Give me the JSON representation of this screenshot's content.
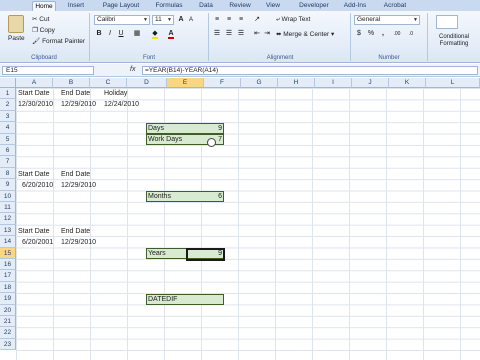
{
  "tabs": [
    "Home",
    "Insert",
    "Page Layout",
    "Formulas",
    "Data",
    "Review",
    "View",
    "Developer",
    "Add-Ins",
    "Acrobat"
  ],
  "active_tab": "Home",
  "ribbon": {
    "paste": "Paste",
    "cut": "Cut",
    "copy": "Copy",
    "format_painter": "Format Painter",
    "clipboard": "Clipboard",
    "font_name": "Calibri",
    "font_size": "11",
    "font": "Font",
    "wrap_text": "Wrap Text",
    "merge_center": "Merge & Center",
    "alignment": "Alignment",
    "number_format": "General",
    "number": "Number",
    "conditional_formatting": "Conditional Formatting"
  },
  "formula_bar": {
    "name_box": "E15",
    "fx": "fx",
    "formula": "=YEAR(B14)-YEAR(A14)"
  },
  "columns": [
    "A",
    "B",
    "C",
    "D",
    "E",
    "F",
    "G",
    "H",
    "I",
    "J",
    "K",
    "L"
  ],
  "rows": [
    "1",
    "2",
    "3",
    "4",
    "5",
    "6",
    "7",
    "8",
    "9",
    "10",
    "11",
    "12",
    "13",
    "14",
    "15",
    "16",
    "17",
    "18",
    "19",
    "20",
    "21",
    "22",
    "23"
  ],
  "cells": {
    "a1": "Start Date",
    "b1": "End Date",
    "c1": "Holiday",
    "a2": "12/30/2010",
    "b2": "12/29/2010",
    "c2": "12/24/2010",
    "d4": "Days",
    "e4": "9",
    "d5": "Work Days",
    "e5": "7",
    "a8": "Start Date",
    "b8": "End Date",
    "a9": "6/20/2010",
    "b9": "12/29/2010",
    "d10": "Months",
    "e10": "6",
    "a13": "Start Date",
    "b13": "End Date",
    "a14": "6/20/2001",
    "b14": "12/29/2010",
    "d15": "Years",
    "e15": "9",
    "d19": "DATEDIF"
  }
}
